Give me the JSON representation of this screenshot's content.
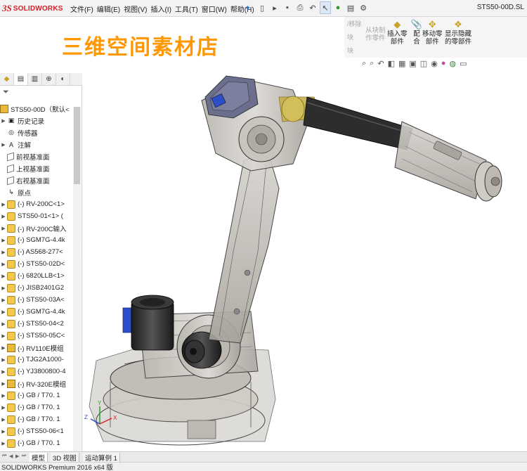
{
  "app": {
    "logo_mark": "3S",
    "logo_text": "SOLIDWORKS"
  },
  "menu": [
    "文件(F)",
    "编辑(E)",
    "视图(V)",
    "插入(I)",
    "工具(T)",
    "窗口(W)",
    "帮助(H)"
  ],
  "document_title": "STS50-00D.SL",
  "banner": "三维空间素材店",
  "ribbon": {
    "disabled_items": [
      "/移除",
      "块",
      "块"
    ],
    "commands": [
      {
        "label_lines": [
          "从块制",
          "作零件"
        ],
        "icon": "block-part-icon",
        "enabled": false
      },
      {
        "label_lines": [
          "插入零",
          "部件"
        ],
        "icon": "insert-component-icon",
        "enabled": true
      },
      {
        "label_lines": [
          "配",
          "合"
        ],
        "icon": "mate-icon",
        "enabled": true
      },
      {
        "label_lines": [
          "移动零",
          "部件"
        ],
        "icon": "move-component-icon",
        "enabled": true
      },
      {
        "label_lines": [
          "显示隐藏",
          "的零部件"
        ],
        "icon": "show-hidden-icon",
        "enabled": true
      }
    ]
  },
  "feature_tree": {
    "root": "STS50-00D（默认<",
    "items": [
      {
        "label": "历史记录",
        "icon": "history-icon",
        "expander": true
      },
      {
        "label": "传感器",
        "icon": "sensor-icon",
        "expander": false
      },
      {
        "label": "注解",
        "icon": "annotation-icon",
        "expander": true
      },
      {
        "label": "前视基准面",
        "icon": "plane-icon",
        "expander": false
      },
      {
        "label": "上视基准面",
        "icon": "plane-icon",
        "expander": false
      },
      {
        "label": "右视基准面",
        "icon": "plane-icon",
        "expander": false
      },
      {
        "label": "原点",
        "icon": "origin-icon",
        "expander": false
      },
      {
        "label": "(-) RV-200C<1>",
        "icon": "component-icon",
        "expander": true
      },
      {
        "label": "STS50-01<1> (",
        "icon": "component-icon",
        "expander": true
      },
      {
        "label": "(-) RV-200C输入",
        "icon": "component-icon",
        "expander": true
      },
      {
        "label": "(-) SGM7G-4.4k",
        "icon": "component-icon",
        "expander": true
      },
      {
        "label": "(-) AS568-277<",
        "icon": "component-icon",
        "expander": true
      },
      {
        "label": "(-) STS50-02D<",
        "icon": "component-icon",
        "expander": true
      },
      {
        "label": "(-) 6820LLB<1>",
        "icon": "component-icon",
        "expander": true
      },
      {
        "label": "(-) JISB2401G2",
        "icon": "component-icon",
        "expander": true
      },
      {
        "label": "(-) STS50-03A<",
        "icon": "component-icon",
        "expander": true
      },
      {
        "label": "(-) SGM7G-4.4k",
        "icon": "component-icon",
        "expander": true
      },
      {
        "label": "(-) STS50-04<2",
        "icon": "component-icon",
        "expander": true
      },
      {
        "label": "(-) STS50-05C<",
        "icon": "component-icon",
        "expander": true
      },
      {
        "label": "(-) RV110E模组",
        "icon": "assembly-icon",
        "expander": true
      },
      {
        "label": "(-) TJG2A1000-",
        "icon": "component-icon",
        "expander": true
      },
      {
        "label": "(-) YJ3800800-4",
        "icon": "component-icon",
        "expander": true
      },
      {
        "label": "(-) RV-320E模组",
        "icon": "assembly-icon",
        "expander": true
      },
      {
        "label": "(-) GB / T70. 1",
        "icon": "component-icon",
        "expander": true
      },
      {
        "label": "(-) GB / T70. 1",
        "icon": "component-icon",
        "expander": true
      },
      {
        "label": "(-) GB / T70. 1",
        "icon": "component-icon",
        "expander": true
      },
      {
        "label": "(-) STS50-06<1",
        "icon": "component-icon",
        "expander": true
      },
      {
        "label": "(-) GB / T70. 1",
        "icon": "component-icon",
        "expander": true
      }
    ]
  },
  "triad": {
    "x": "X",
    "y": "Y",
    "z": "Z"
  },
  "bottom_tabs": [
    "模型",
    "3D 视图",
    "运动算例 1"
  ],
  "status": "SOLIDWORKS Premium 2016 x64 版",
  "colors": {
    "brand": "#d42027",
    "banner": "#ff9800",
    "robot_body": "#c9c6c2",
    "motor": "#2a2a2a",
    "accent_blue": "#2a4fc8",
    "accent_yellow": "#c8b24a"
  }
}
